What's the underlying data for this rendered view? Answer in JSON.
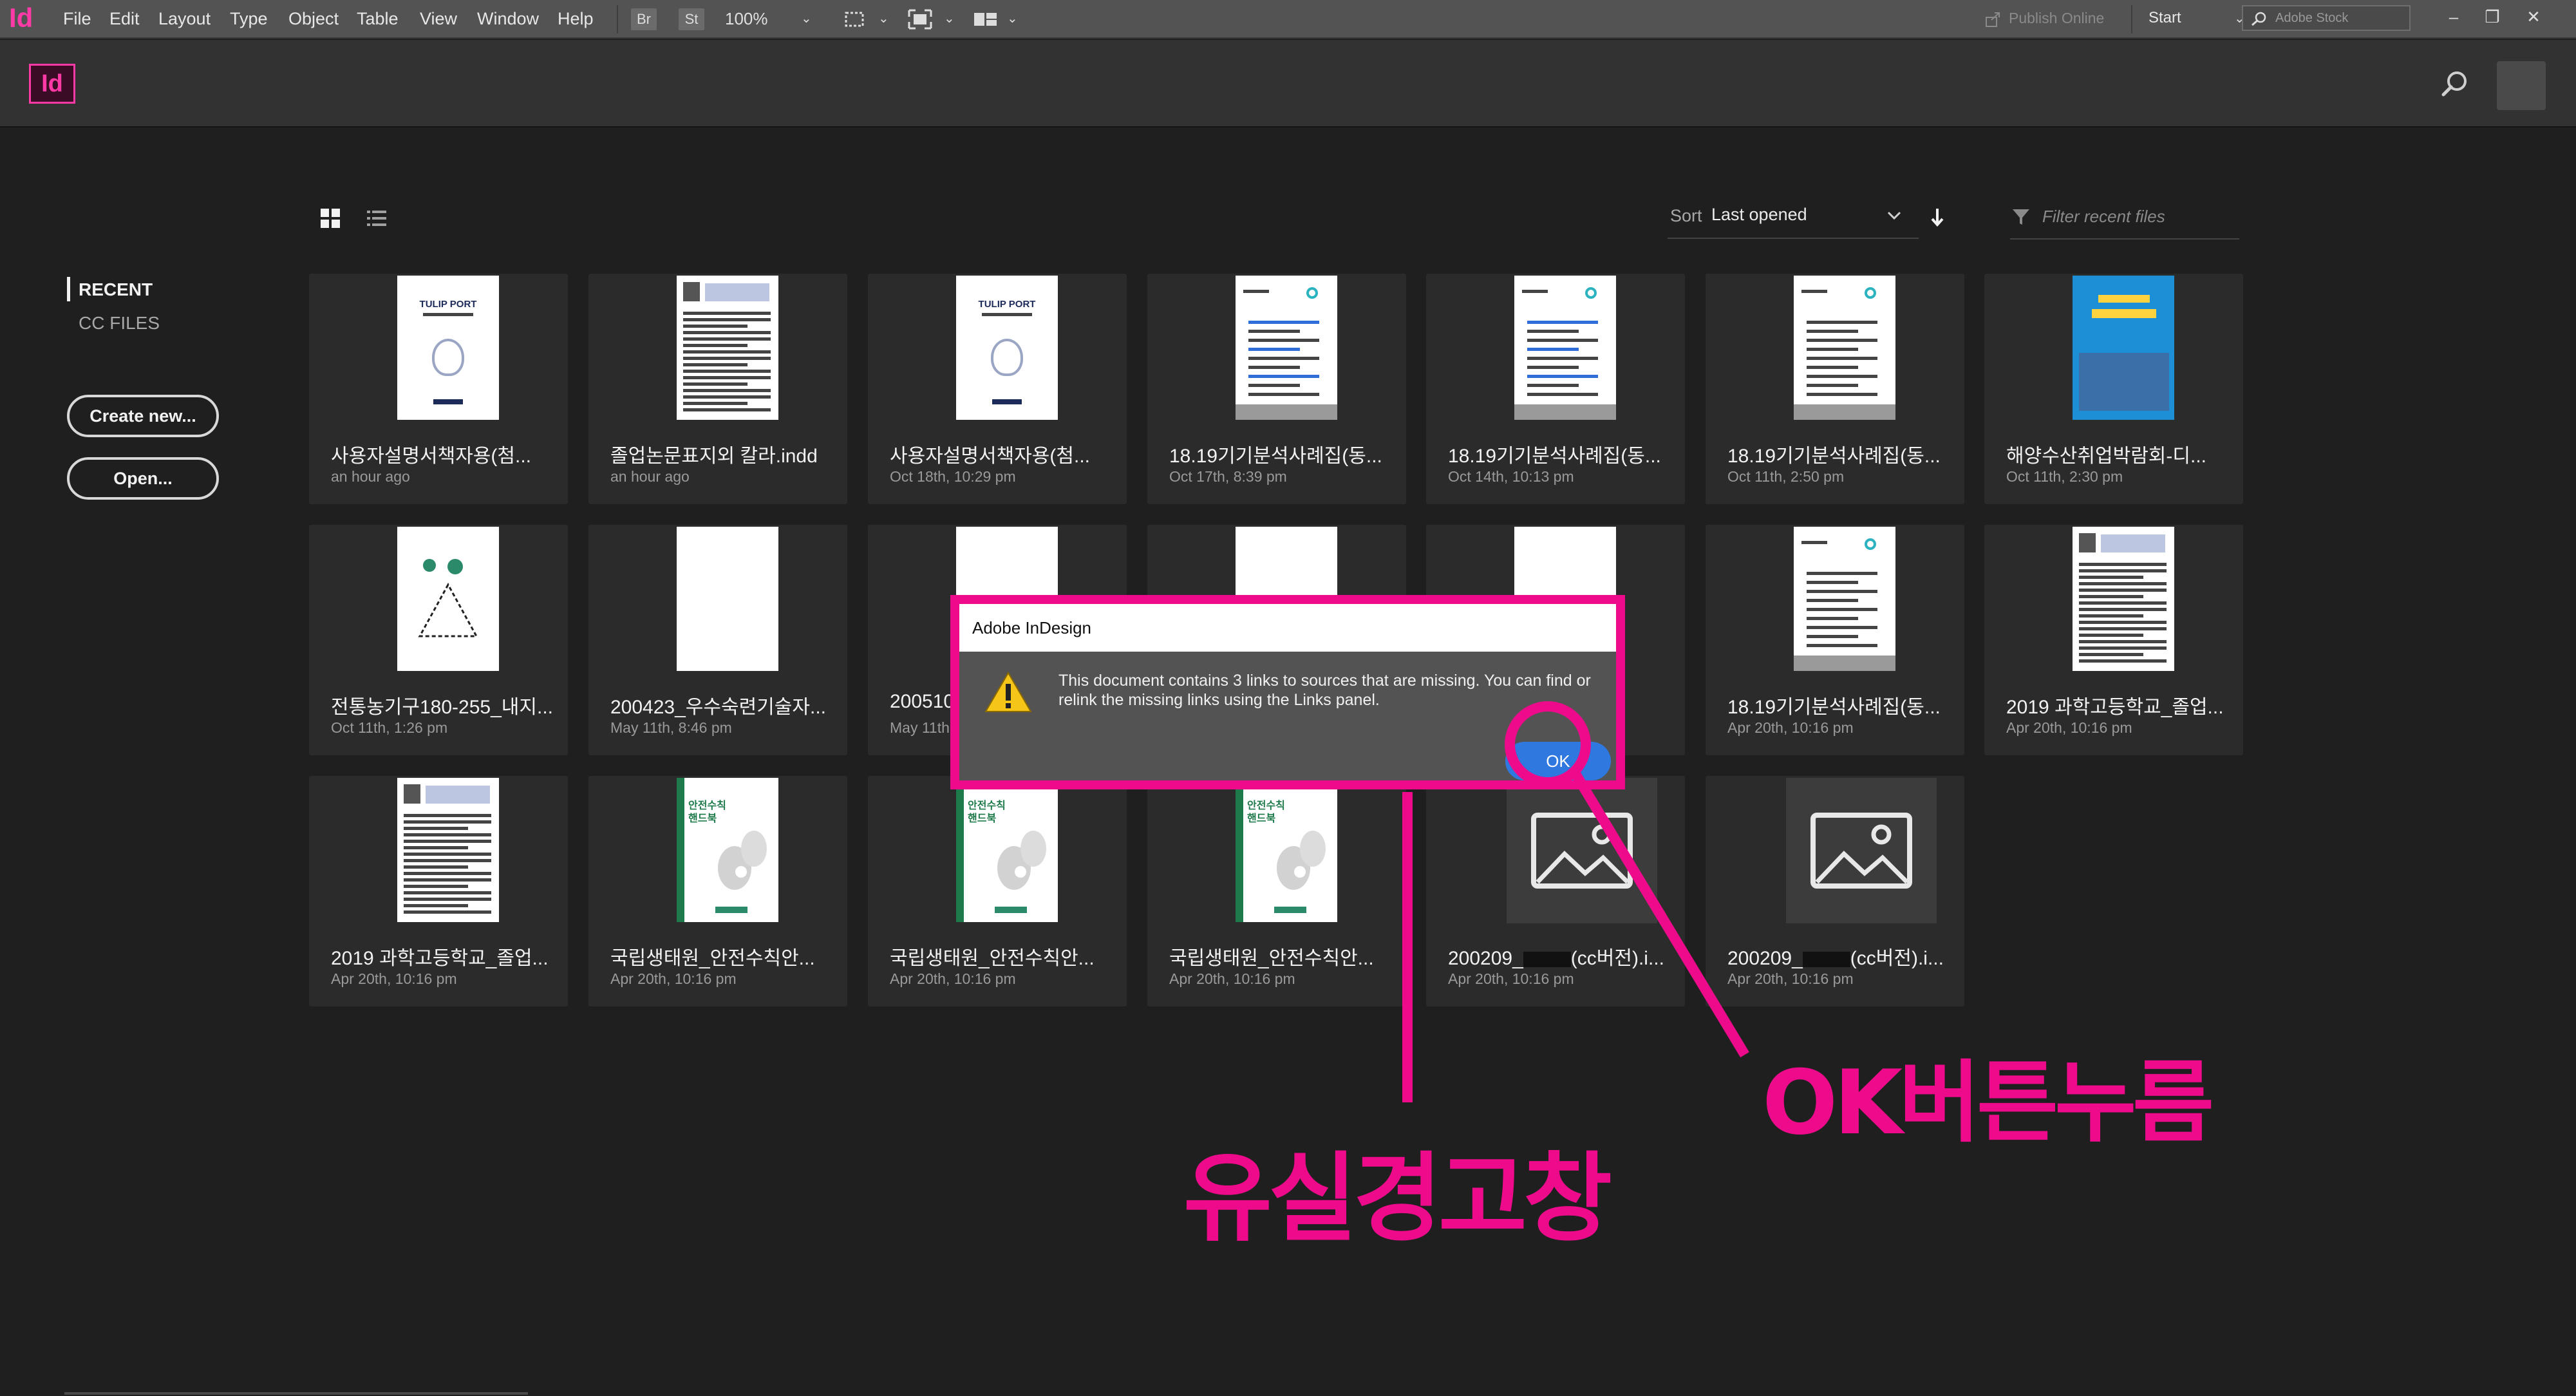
{
  "menubar": {
    "app_logo": "Id",
    "menus": [
      "File",
      "Edit",
      "Layout",
      "Type",
      "Object",
      "Table",
      "View",
      "Window",
      "Help"
    ],
    "bridge_label": "Br",
    "stock_label": "St",
    "zoom": "100%",
    "publish_online": "Publish Online",
    "workspace": "Start",
    "stock_search_placeholder": "Adobe Stock"
  },
  "header": {
    "logo": "Id"
  },
  "nav": {
    "recent": "RECENT",
    "cc_files": "CC FILES",
    "create_new": "Create new...",
    "open": "Open..."
  },
  "toolbar": {
    "sort_label": "Sort",
    "sort_value": "Last opened",
    "filter_placeholder": "Filter recent files"
  },
  "files": [
    {
      "name": "사용자설명서책자용(첨...",
      "date": "an hour ago",
      "thumb": "tulip"
    },
    {
      "name": "졸업논문표지외 칼라.indd",
      "date": "an hour ago",
      "thumb": "paper"
    },
    {
      "name": "사용자설명서책자용(첨...",
      "date": "Oct 18th, 10:29 pm",
      "thumb": "tulip"
    },
    {
      "name": "18.19기기분석사례집(동...",
      "date": "Oct 17th, 8:39 pm",
      "thumb": "report-blue"
    },
    {
      "name": "18.19기기분석사례집(동...",
      "date": "Oct 14th, 10:13 pm",
      "thumb": "report-blue"
    },
    {
      "name": "18.19기기분석사례집(동...",
      "date": "Oct 11th, 2:50 pm",
      "thumb": "report-gray"
    },
    {
      "name": "해양수산취업박람회-디...",
      "date": "Oct 11th, 2:30 pm",
      "thumb": "poster"
    },
    {
      "name": "전통농기구180-255_내지...",
      "date": "Oct 11th, 1:26 pm",
      "thumb": "illustration"
    },
    {
      "name": "200423_우수숙련기술자...",
      "date": "May 11th, 8:46 pm",
      "thumb": "blank"
    },
    {
      "name": "200510",
      "date": "May 11th",
      "thumb": "blank"
    },
    {
      "name": "",
      "date": "",
      "thumb": "blank"
    },
    {
      "name": "",
      "date": "",
      "thumb": "blank"
    },
    {
      "name": "18.19기기분석사례집(동...",
      "date": "Apr 20th, 10:16 pm",
      "thumb": "report-gray"
    },
    {
      "name": "2019 과학고등학교_졸업...",
      "date": "Apr 20th, 10:16 pm",
      "thumb": "paper"
    },
    {
      "name": "2019 과학고등학교_졸업...",
      "date": "Apr 20th, 10:16 pm",
      "thumb": "paper"
    },
    {
      "name": "국립생태원_안전수칙안...",
      "date": "Apr 20th, 10:16 pm",
      "thumb": "safety"
    },
    {
      "name": "국립생태원_안전수칙안...",
      "date": "Apr 20th, 10:16 pm",
      "thumb": "safety"
    },
    {
      "name": "국립생태원_안전수칙안...",
      "date": "Apr 20th, 10:16 pm",
      "thumb": "safety"
    },
    {
      "name_prefix": "200209_",
      "name_suffix": "(cc버전).i...",
      "date": "Apr 20th, 10:16 pm",
      "thumb": "placeholder"
    },
    {
      "name_prefix": "200209_",
      "name_suffix": "(cc버전).i...",
      "date": "Apr 20th, 10:16 pm",
      "thumb": "placeholder"
    }
  ],
  "thumb_text": {
    "tulip_title": "TULIP PORT",
    "safety_title_1": "안전수칙",
    "safety_title_2": "핸드북"
  },
  "dialog": {
    "title": "Adobe InDesign",
    "message": "This document contains 3 links to sources that are missing. You can find or relink the missing links using the Links panel.",
    "ok": "OK"
  },
  "annotations": {
    "missing_warning": "유실경고창",
    "press_ok": "OK버튼누름",
    "color": "#ed0b8c"
  }
}
